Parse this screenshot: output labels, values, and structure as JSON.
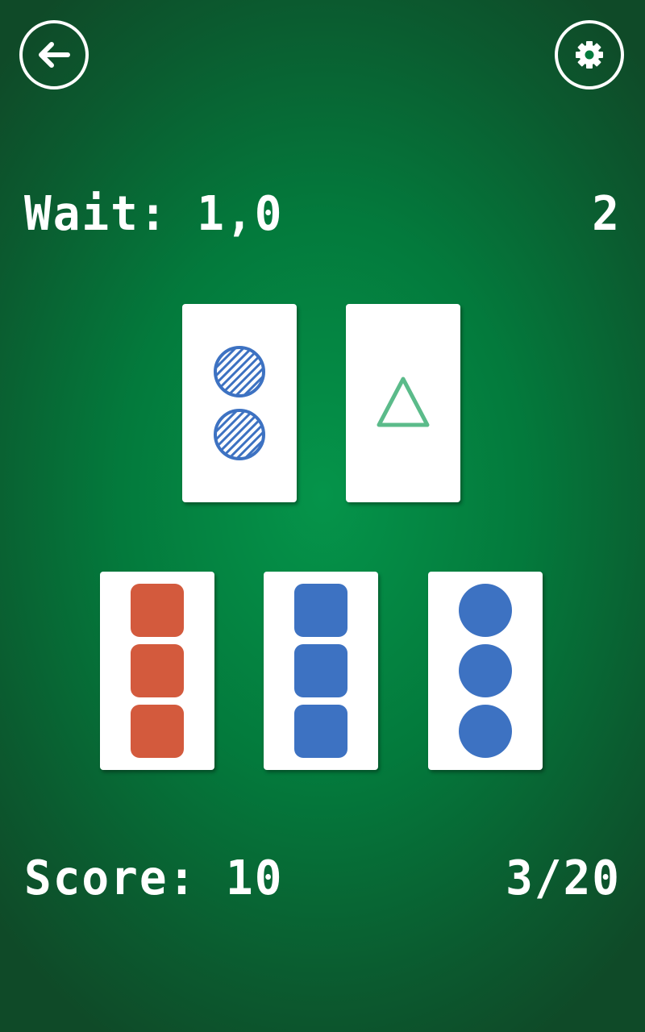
{
  "header": {
    "back_icon": "arrow-left-icon",
    "settings_icon": "gear-icon"
  },
  "hud": {
    "wait": "Wait: 1,0",
    "round": "2",
    "score": "Score: 10",
    "progress": "3/20"
  },
  "colors": {
    "table_green": "#05944a",
    "card": "#ffffff",
    "red": "#d35a3d",
    "blue": "#3d72c2",
    "green": "#5bbb8a"
  },
  "target_cards": [
    {
      "count": 2,
      "shape": "circle",
      "color": "blue",
      "fill": "striped"
    },
    {
      "count": 1,
      "shape": "triangle",
      "color": "green",
      "fill": "outline"
    }
  ],
  "choice_cards": [
    {
      "count": 3,
      "shape": "square",
      "color": "red",
      "fill": "solid"
    },
    {
      "count": 3,
      "shape": "square",
      "color": "blue",
      "fill": "solid"
    },
    {
      "count": 3,
      "shape": "circle",
      "color": "blue",
      "fill": "solid"
    }
  ]
}
